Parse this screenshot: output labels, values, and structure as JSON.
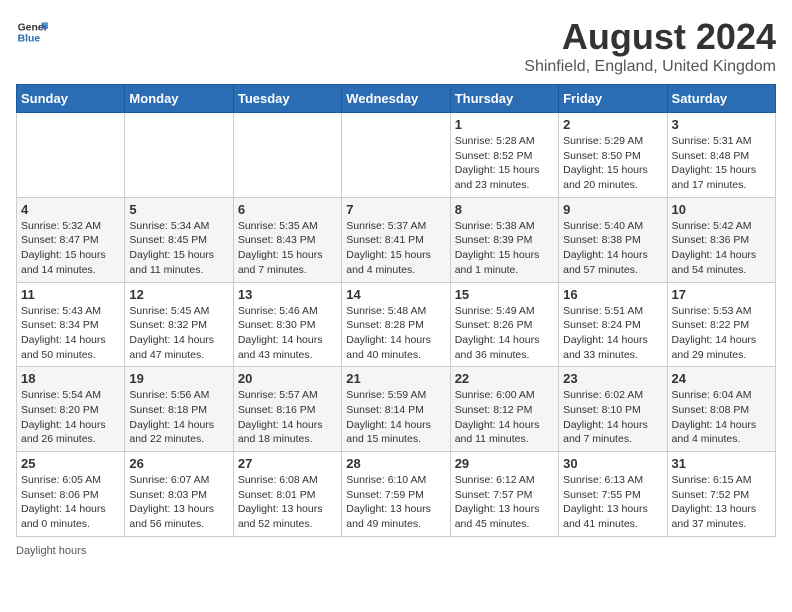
{
  "logo": {
    "text_general": "General",
    "text_blue": "Blue"
  },
  "header": {
    "title": "August 2024",
    "subtitle": "Shinfield, England, United Kingdom"
  },
  "calendar": {
    "days_of_week": [
      "Sunday",
      "Monday",
      "Tuesday",
      "Wednesday",
      "Thursday",
      "Friday",
      "Saturday"
    ],
    "weeks": [
      [
        {
          "day": "",
          "sunrise": "",
          "sunset": "",
          "daylight": ""
        },
        {
          "day": "",
          "sunrise": "",
          "sunset": "",
          "daylight": ""
        },
        {
          "day": "",
          "sunrise": "",
          "sunset": "",
          "daylight": ""
        },
        {
          "day": "",
          "sunrise": "",
          "sunset": "",
          "daylight": ""
        },
        {
          "day": "1",
          "sunrise": "Sunrise: 5:28 AM",
          "sunset": "Sunset: 8:52 PM",
          "daylight": "Daylight: 15 hours and 23 minutes."
        },
        {
          "day": "2",
          "sunrise": "Sunrise: 5:29 AM",
          "sunset": "Sunset: 8:50 PM",
          "daylight": "Daylight: 15 hours and 20 minutes."
        },
        {
          "day": "3",
          "sunrise": "Sunrise: 5:31 AM",
          "sunset": "Sunset: 8:48 PM",
          "daylight": "Daylight: 15 hours and 17 minutes."
        }
      ],
      [
        {
          "day": "4",
          "sunrise": "Sunrise: 5:32 AM",
          "sunset": "Sunset: 8:47 PM",
          "daylight": "Daylight: 15 hours and 14 minutes."
        },
        {
          "day": "5",
          "sunrise": "Sunrise: 5:34 AM",
          "sunset": "Sunset: 8:45 PM",
          "daylight": "Daylight: 15 hours and 11 minutes."
        },
        {
          "day": "6",
          "sunrise": "Sunrise: 5:35 AM",
          "sunset": "Sunset: 8:43 PM",
          "daylight": "Daylight: 15 hours and 7 minutes."
        },
        {
          "day": "7",
          "sunrise": "Sunrise: 5:37 AM",
          "sunset": "Sunset: 8:41 PM",
          "daylight": "Daylight: 15 hours and 4 minutes."
        },
        {
          "day": "8",
          "sunrise": "Sunrise: 5:38 AM",
          "sunset": "Sunset: 8:39 PM",
          "daylight": "Daylight: 15 hours and 1 minute."
        },
        {
          "day": "9",
          "sunrise": "Sunrise: 5:40 AM",
          "sunset": "Sunset: 8:38 PM",
          "daylight": "Daylight: 14 hours and 57 minutes."
        },
        {
          "day": "10",
          "sunrise": "Sunrise: 5:42 AM",
          "sunset": "Sunset: 8:36 PM",
          "daylight": "Daylight: 14 hours and 54 minutes."
        }
      ],
      [
        {
          "day": "11",
          "sunrise": "Sunrise: 5:43 AM",
          "sunset": "Sunset: 8:34 PM",
          "daylight": "Daylight: 14 hours and 50 minutes."
        },
        {
          "day": "12",
          "sunrise": "Sunrise: 5:45 AM",
          "sunset": "Sunset: 8:32 PM",
          "daylight": "Daylight: 14 hours and 47 minutes."
        },
        {
          "day": "13",
          "sunrise": "Sunrise: 5:46 AM",
          "sunset": "Sunset: 8:30 PM",
          "daylight": "Daylight: 14 hours and 43 minutes."
        },
        {
          "day": "14",
          "sunrise": "Sunrise: 5:48 AM",
          "sunset": "Sunset: 8:28 PM",
          "daylight": "Daylight: 14 hours and 40 minutes."
        },
        {
          "day": "15",
          "sunrise": "Sunrise: 5:49 AM",
          "sunset": "Sunset: 8:26 PM",
          "daylight": "Daylight: 14 hours and 36 minutes."
        },
        {
          "day": "16",
          "sunrise": "Sunrise: 5:51 AM",
          "sunset": "Sunset: 8:24 PM",
          "daylight": "Daylight: 14 hours and 33 minutes."
        },
        {
          "day": "17",
          "sunrise": "Sunrise: 5:53 AM",
          "sunset": "Sunset: 8:22 PM",
          "daylight": "Daylight: 14 hours and 29 minutes."
        }
      ],
      [
        {
          "day": "18",
          "sunrise": "Sunrise: 5:54 AM",
          "sunset": "Sunset: 8:20 PM",
          "daylight": "Daylight: 14 hours and 26 minutes."
        },
        {
          "day": "19",
          "sunrise": "Sunrise: 5:56 AM",
          "sunset": "Sunset: 8:18 PM",
          "daylight": "Daylight: 14 hours and 22 minutes."
        },
        {
          "day": "20",
          "sunrise": "Sunrise: 5:57 AM",
          "sunset": "Sunset: 8:16 PM",
          "daylight": "Daylight: 14 hours and 18 minutes."
        },
        {
          "day": "21",
          "sunrise": "Sunrise: 5:59 AM",
          "sunset": "Sunset: 8:14 PM",
          "daylight": "Daylight: 14 hours and 15 minutes."
        },
        {
          "day": "22",
          "sunrise": "Sunrise: 6:00 AM",
          "sunset": "Sunset: 8:12 PM",
          "daylight": "Daylight: 14 hours and 11 minutes."
        },
        {
          "day": "23",
          "sunrise": "Sunrise: 6:02 AM",
          "sunset": "Sunset: 8:10 PM",
          "daylight": "Daylight: 14 hours and 7 minutes."
        },
        {
          "day": "24",
          "sunrise": "Sunrise: 6:04 AM",
          "sunset": "Sunset: 8:08 PM",
          "daylight": "Daylight: 14 hours and 4 minutes."
        }
      ],
      [
        {
          "day": "25",
          "sunrise": "Sunrise: 6:05 AM",
          "sunset": "Sunset: 8:06 PM",
          "daylight": "Daylight: 14 hours and 0 minutes."
        },
        {
          "day": "26",
          "sunrise": "Sunrise: 6:07 AM",
          "sunset": "Sunset: 8:03 PM",
          "daylight": "Daylight: 13 hours and 56 minutes."
        },
        {
          "day": "27",
          "sunrise": "Sunrise: 6:08 AM",
          "sunset": "Sunset: 8:01 PM",
          "daylight": "Daylight: 13 hours and 52 minutes."
        },
        {
          "day": "28",
          "sunrise": "Sunrise: 6:10 AM",
          "sunset": "Sunset: 7:59 PM",
          "daylight": "Daylight: 13 hours and 49 minutes."
        },
        {
          "day": "29",
          "sunrise": "Sunrise: 6:12 AM",
          "sunset": "Sunset: 7:57 PM",
          "daylight": "Daylight: 13 hours and 45 minutes."
        },
        {
          "day": "30",
          "sunrise": "Sunrise: 6:13 AM",
          "sunset": "Sunset: 7:55 PM",
          "daylight": "Daylight: 13 hours and 41 minutes."
        },
        {
          "day": "31",
          "sunrise": "Sunrise: 6:15 AM",
          "sunset": "Sunset: 7:52 PM",
          "daylight": "Daylight: 13 hours and 37 minutes."
        }
      ]
    ]
  },
  "footer": {
    "note": "Daylight hours"
  }
}
